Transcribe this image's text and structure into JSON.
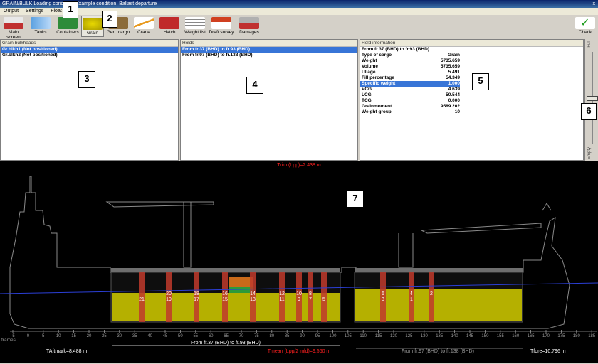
{
  "window": {
    "title": "GRAIN/BULK  Loading condition: Example condition: Ballast departure",
    "close": "x"
  },
  "menu": [
    "Output",
    "Settings",
    "Float"
  ],
  "toolbar": [
    {
      "label": "Main screen",
      "icon": "ship-icon"
    },
    {
      "label": "Tanks",
      "icon": "tanks-icon"
    },
    {
      "label": "Containers",
      "icon": "containers-icon"
    },
    {
      "label": "Grain",
      "icon": "grain-icon"
    },
    {
      "label": "Gen. cargo",
      "icon": "general-cargo-icon"
    },
    {
      "label": "Crane",
      "icon": "crane-icon"
    },
    {
      "label": "Hatch",
      "icon": "hatch-icon"
    },
    {
      "label": "Weight list",
      "icon": "weight-list-icon"
    },
    {
      "label": "Draft survey",
      "icon": "draft-survey-icon"
    },
    {
      "label": "Damages",
      "icon": "damages-icon"
    },
    {
      "label": "Check",
      "icon": "checkmark-icon"
    }
  ],
  "bulkheads": {
    "caption": "Grain bulkheads",
    "items": [
      "Gr.blkh1 (Not positioned)",
      "Gr.blkh2 (Not positioned)"
    ],
    "selected": 0
  },
  "holds": {
    "caption": "Holds",
    "items": [
      "From fr.37 (BHD) to fr.93 (BHD)",
      "From fr.97 (BHD) to fr.138 (BHD)"
    ],
    "selected": 0
  },
  "hold_info": {
    "caption": "Hold information",
    "header": "From fr.37 (BHD) to fr.93 (BHD)",
    "rows": [
      {
        "label": "Type of cargo",
        "value": "Grain"
      },
      {
        "label": "Weight",
        "value": "5735.659"
      },
      {
        "label": "Volume",
        "value": "5735.659"
      },
      {
        "label": "Ullage",
        "value": "5.491"
      },
      {
        "label": "Fill percentage",
        "value": "54.349"
      },
      {
        "label": "Specific weight",
        "value": "1.000"
      },
      {
        "label": "VCG",
        "value": "4.639"
      },
      {
        "label": "LCG",
        "value": "50.544"
      },
      {
        "label": "TCG",
        "value": "0.000"
      },
      {
        "label": "Grainmoment",
        "value": "9589.202"
      },
      {
        "label": "Weight group",
        "value": "10"
      }
    ],
    "selected": 5
  },
  "slider": {
    "top_label": "Full",
    "bottom_label": "Empty"
  },
  "profile": {
    "trim": "Trim (Lpp)=2.438 m",
    "aft": "TAftmark=8.488 m",
    "mean": "Tmean (Lpp/2 mld)=9.560 m",
    "fore": "Tfore=10.796 m",
    "frames_label": "frames",
    "hold1_label": "From fr.37 (BHD) to fr.93 (BHD)",
    "hold2_label": "From fr.97 (BHD) to fr.138 (BHD)",
    "frame_ticks": [
      "-5",
      "0",
      "5",
      "10",
      "15",
      "20",
      "25",
      "30",
      "35",
      "40",
      "45",
      "50",
      "55",
      "60",
      "65",
      "70",
      "75",
      "80",
      "85",
      "90",
      "95",
      "100",
      "105",
      "110",
      "115",
      "120",
      "125",
      "130",
      "135",
      "140",
      "145",
      "150",
      "155",
      "160",
      "165",
      "170",
      "175",
      "180",
      "185"
    ],
    "bulkhead_top_numbers": [
      "20",
      "18",
      "16",
      "14",
      "12",
      "10",
      "8",
      "6",
      "4",
      "2"
    ],
    "bulkhead_bottom_numbers": [
      "21",
      "19",
      "17",
      "15",
      "13",
      "11",
      "9",
      "7",
      "5",
      "3",
      "1"
    ]
  },
  "colors": {
    "grain": "#b5b000",
    "bulkhead": "#c0392b",
    "selection": "#3875d7",
    "waterline": "#2b3fd6",
    "trim_text": "#ff2020"
  },
  "annotations": [
    "1",
    "2",
    "3",
    "4",
    "5",
    "6",
    "7"
  ]
}
